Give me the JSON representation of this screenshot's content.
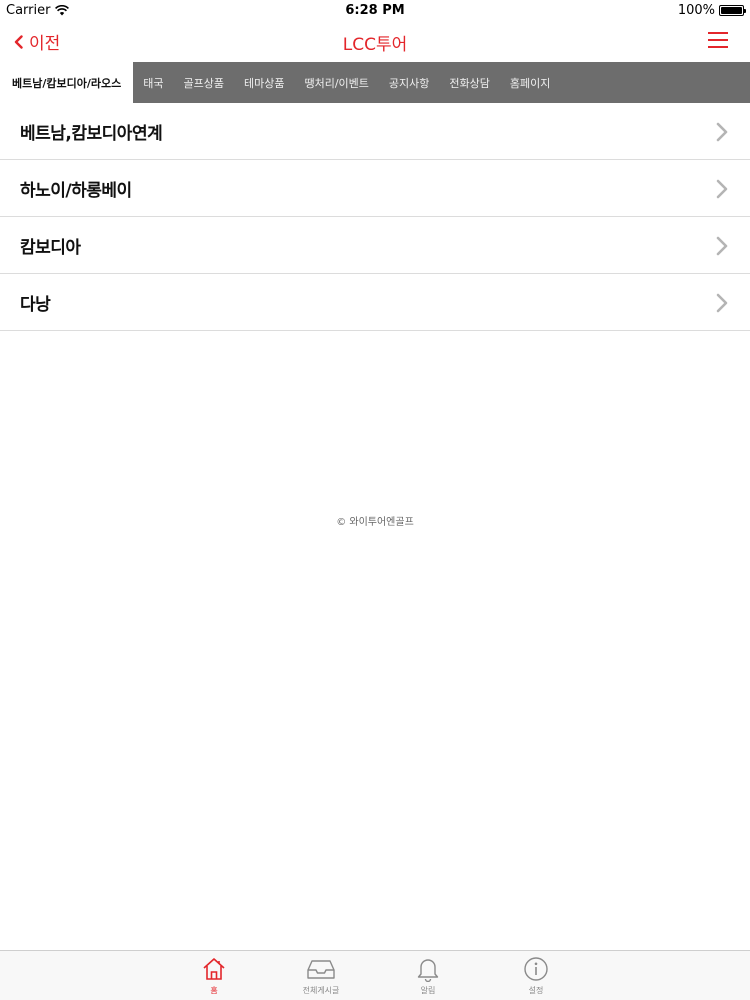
{
  "status_bar": {
    "carrier": "Carrier",
    "time": "6:28 PM",
    "battery": "100%"
  },
  "nav": {
    "back_label": "이전",
    "title": "LCC투어",
    "menu_icon": "hamburger-menu-icon",
    "accent_color": "#e3262b"
  },
  "tabs": [
    {
      "label": "베트남/캄보디아/라오스",
      "active": true
    },
    {
      "label": "태국"
    },
    {
      "label": "골프상품"
    },
    {
      "label": "테마상품"
    },
    {
      "label": "땡처리/이벤트"
    },
    {
      "label": "공지사항"
    },
    {
      "label": "전화상담"
    },
    {
      "label": "홈페이지"
    }
  ],
  "list": [
    {
      "label": "베트남,캄보디아연계"
    },
    {
      "label": "하노이/하롱베이"
    },
    {
      "label": "캄보디아"
    },
    {
      "label": "다낭"
    }
  ],
  "footer": {
    "copyright": "© 와이투어엔골프"
  },
  "bottom_tabs": [
    {
      "label": "홈",
      "icon": "home-icon",
      "active": true
    },
    {
      "label": "전체게시글",
      "icon": "inbox-icon"
    },
    {
      "label": "알림",
      "icon": "bell-icon"
    },
    {
      "label": "설정",
      "icon": "info-icon"
    }
  ]
}
